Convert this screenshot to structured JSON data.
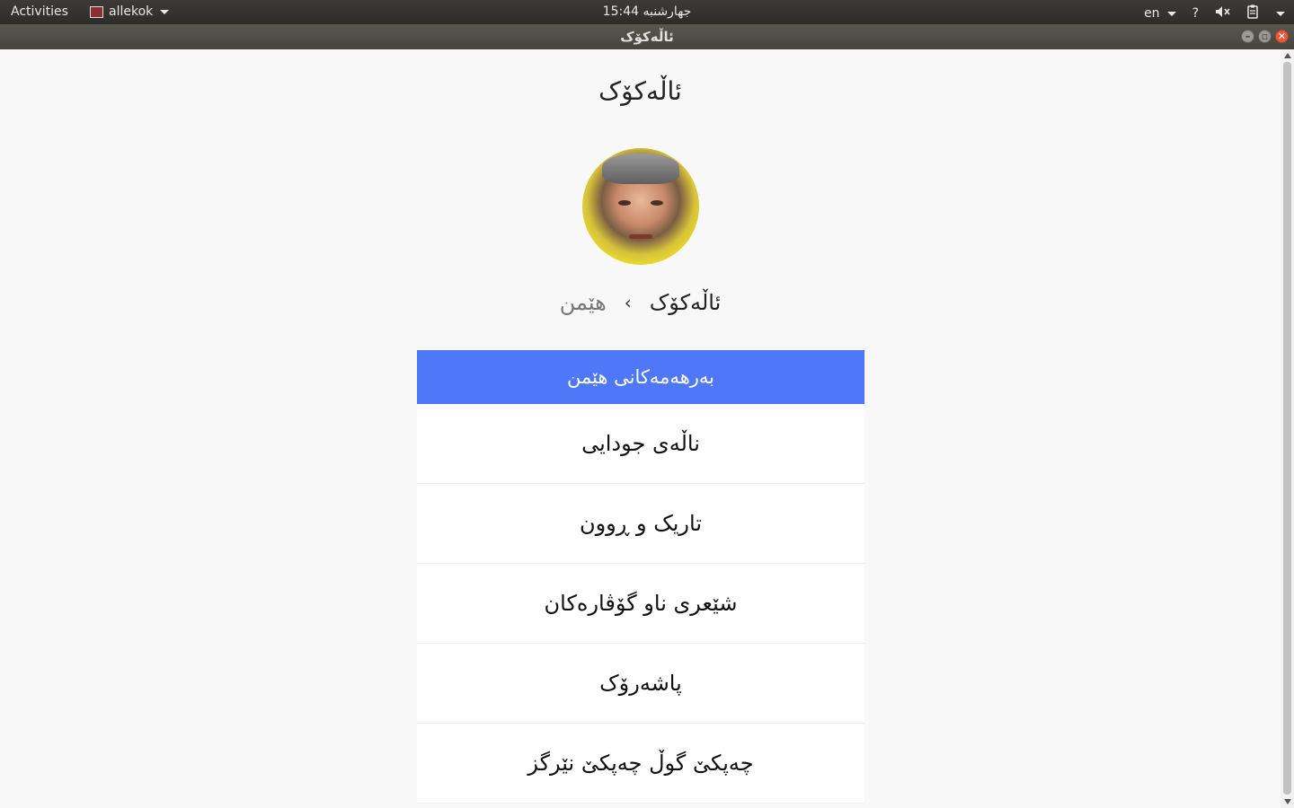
{
  "topbar": {
    "activities": "Activities",
    "app_name": "allekok",
    "clock": "جهارشنبه 15:44",
    "language": "en",
    "icons": [
      "help-icon",
      "volume-muted-icon",
      "clipboard-icon",
      "system-menu-caret-icon"
    ]
  },
  "window": {
    "title": "ئاڵەکۆک"
  },
  "page": {
    "title": "ئاڵەکۆک",
    "breadcrumb": {
      "home": "ئاڵەکۆک",
      "separator": "›",
      "current": "هێمن"
    },
    "list_header": "بەرهەمەکانی هێمن",
    "items": [
      "ناڵەی جودایی",
      "تاریک و ڕوون",
      "شێعری ناو گۆڤارەکان",
      "پاشەرۆک",
      "چەپکێ گوڵ چەپکێ نێرگز"
    ]
  },
  "colors": {
    "accent": "#4f78f8",
    "topbar": "#3c3b37",
    "close_button": "#e9583a"
  }
}
